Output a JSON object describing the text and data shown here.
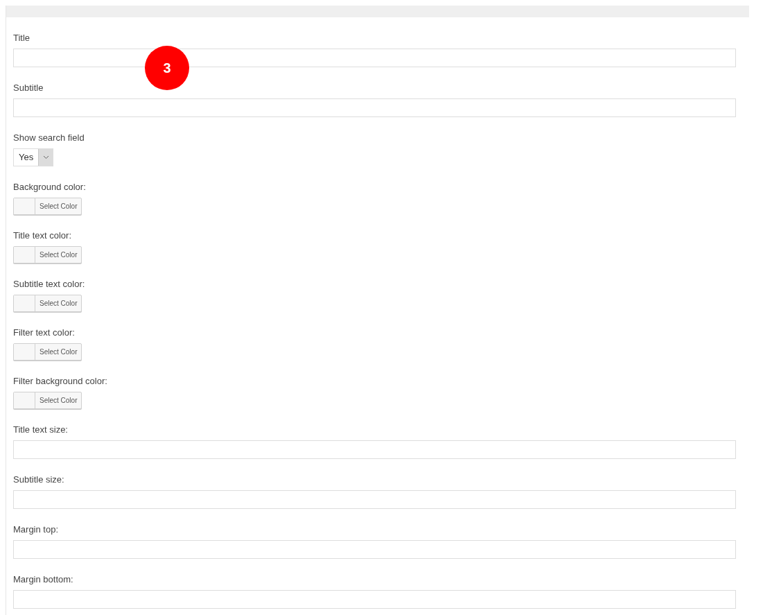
{
  "badge": "3",
  "fields": [
    {
      "kind": "text",
      "label": "Title"
    },
    {
      "kind": "text",
      "label": "Subtitle"
    },
    {
      "kind": "select",
      "label": "Show search field",
      "value": "Yes"
    },
    {
      "kind": "color",
      "label": "Background color:",
      "button": "Select Color"
    },
    {
      "kind": "color",
      "label": "Title text color:",
      "button": "Select Color"
    },
    {
      "kind": "color",
      "label": "Subtitle text color:",
      "button": "Select Color"
    },
    {
      "kind": "color",
      "label": "Filter text color:",
      "button": "Select Color"
    },
    {
      "kind": "color",
      "label": "Filter background color:",
      "button": "Select Color"
    },
    {
      "kind": "text",
      "label": "Title text size:"
    },
    {
      "kind": "text",
      "label": "Subtitle size:"
    },
    {
      "kind": "text",
      "label": "Margin top:"
    },
    {
      "kind": "text",
      "label": "Margin bottom:"
    }
  ]
}
